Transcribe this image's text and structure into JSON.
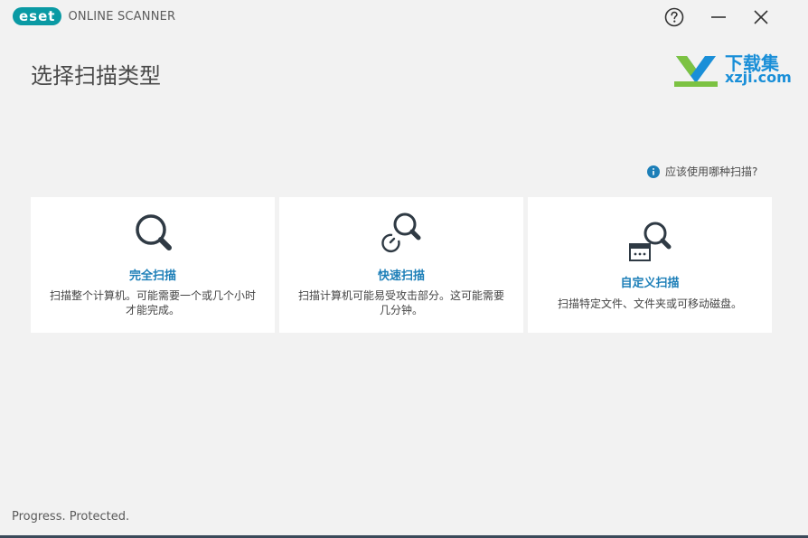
{
  "app": {
    "brand_badge": "eset",
    "brand_text": "ONLINE SCANNER",
    "accent_color": "#0a9aa4",
    "link_color": "#1d7fb8"
  },
  "window_controls": {
    "help_icon": "help-circle-icon",
    "minimize_icon": "minimize-icon",
    "close_icon": "close-icon"
  },
  "page": {
    "title": "选择扫描类型"
  },
  "watermark": {
    "text": "下载集",
    "sub": "xzji.com"
  },
  "help_link": {
    "label": "应该使用哪种扫描?",
    "icon": "info-icon"
  },
  "cards": [
    {
      "icon": "magnifier-icon",
      "title": "完全扫描",
      "desc": "扫描整个计算机。可能需要一个或几个小时才能完成。"
    },
    {
      "icon": "quick-scan-icon",
      "title": "快速扫描",
      "desc": "扫描计算机可能易受攻击部分。这可能需要几分钟。"
    },
    {
      "icon": "custom-scan-icon",
      "title": "自定义扫描",
      "desc": "扫描特定文件、文件夹或可移动磁盘。"
    }
  ],
  "footer": {
    "tagline": "Progress. Protected."
  }
}
